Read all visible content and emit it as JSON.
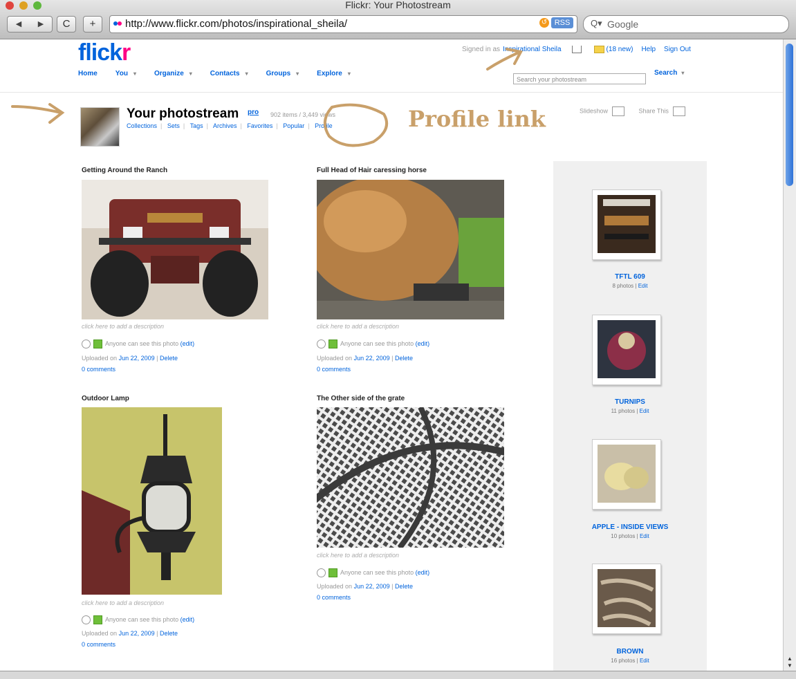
{
  "window": {
    "title": "Flickr: Your Photostream"
  },
  "browser": {
    "back_label": "◀",
    "forward_label": "▶",
    "reload_label": "C",
    "add_label": "+",
    "url": "http://www.flickr.com/photos/inspirational_sheila/",
    "rss_label": "RSS",
    "search_placeholder": "Google"
  },
  "header": {
    "logo_main": "flick",
    "logo_accent": "r",
    "signed_in_prefix": "Signed in as",
    "username": "Inspirational Sheila",
    "new_count": "(18 new)",
    "help": "Help",
    "sign_out": "Sign Out",
    "nav": [
      "Home",
      "You",
      "Organize",
      "Contacts",
      "Groups",
      "Explore"
    ],
    "search_placeholder": "Search your photostream",
    "search_label": "Search"
  },
  "profile": {
    "title": "Your photostream",
    "pro": "pro",
    "counts": "902 items / 3,449 views",
    "links": [
      "Collections",
      "Sets",
      "Tags",
      "Archives",
      "Favorites",
      "Popular",
      "Profile"
    ],
    "slideshow": "Slideshow",
    "share": "Share This"
  },
  "annotation": {
    "text": "Profile link"
  },
  "photos": [
    {
      "title": "Getting Around the Ranch",
      "description": "click here to add a description",
      "visibility": "Anyone can see this photo",
      "edit": "(edit)",
      "uploaded_prefix": "Uploaded on",
      "date": "Jun 22, 2009",
      "delete": "Delete",
      "comments": "0 comments"
    },
    {
      "title": "Full Head of Hair caressing horse",
      "description": "click here to add a description",
      "visibility": "Anyone can see this photo",
      "edit": "(edit)",
      "uploaded_prefix": "Uploaded on",
      "date": "Jun 22, 2009",
      "delete": "Delete",
      "comments": "0 comments"
    },
    {
      "title": "Outdoor Lamp",
      "description": "click here to add a description",
      "visibility": "Anyone can see this photo",
      "edit": "(edit)",
      "uploaded_prefix": "Uploaded on",
      "date": "Jun 22, 2009",
      "delete": "Delete",
      "comments": "0 comments"
    },
    {
      "title": "The Other side of the grate",
      "description": "click here to add a description",
      "visibility": "Anyone can see this photo",
      "edit": "(edit)",
      "uploaded_prefix": "Uploaded on",
      "date": "Jun 22, 2009",
      "delete": "Delete",
      "comments": "0 comments"
    }
  ],
  "sets": [
    {
      "name": "TFTL 609",
      "count": "8 photos",
      "edit": "Edit"
    },
    {
      "name": "TURNIPS",
      "count": "11 photos",
      "edit": "Edit"
    },
    {
      "name": "APPLE - INSIDE VIEWS",
      "count": "10 photos",
      "edit": "Edit"
    },
    {
      "name": "BROWN",
      "count": "16 photos",
      "edit": "Edit"
    }
  ],
  "colors": {
    "flickr_blue": "#0063dc",
    "flickr_pink": "#ff0084",
    "annotation": "#c9a06a"
  }
}
